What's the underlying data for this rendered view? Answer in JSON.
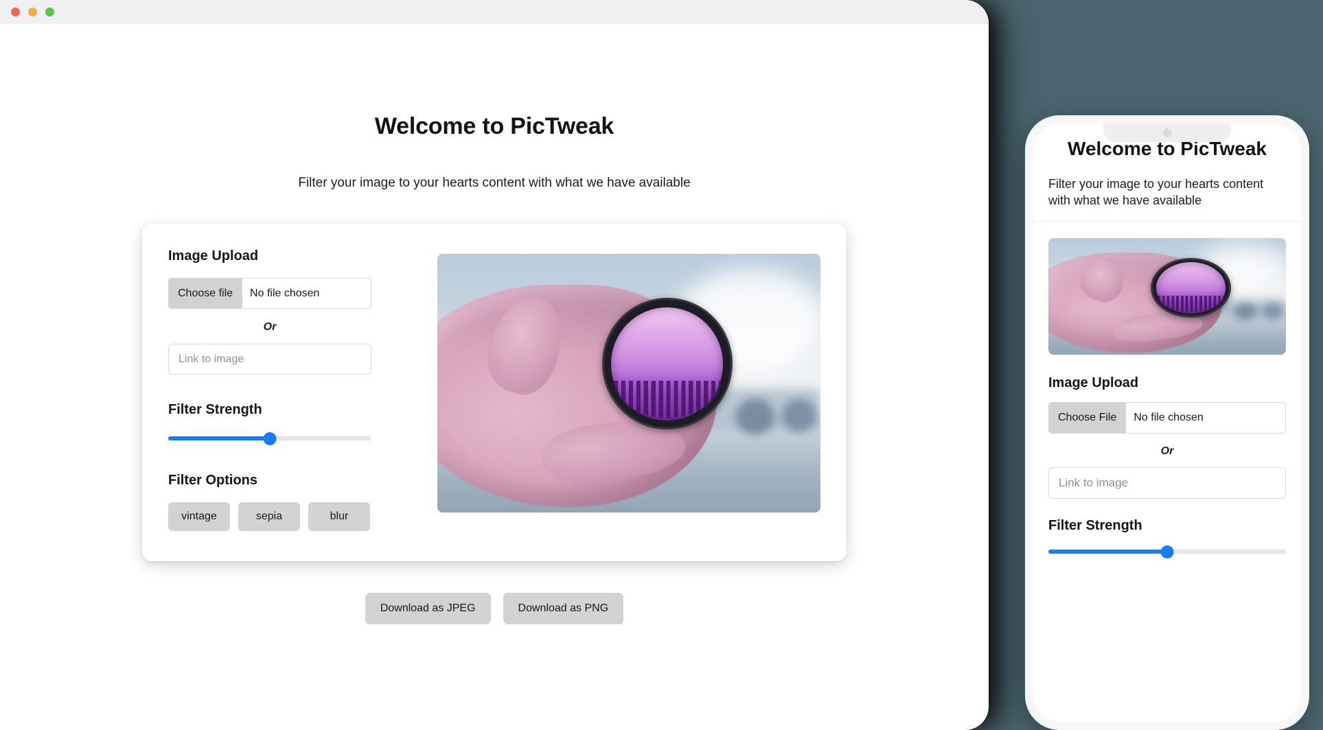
{
  "app": {
    "title": "Welcome to PicTweak",
    "subtitle": "Filter your image to your hearts content with what we have available"
  },
  "window_controls": {
    "close_label": "close",
    "minimize_label": "minimize",
    "maximize_label": "maximize",
    "close_color": "#f2645a",
    "minimize_color": "#eeb040",
    "maximize_color": "#57c749"
  },
  "desktop": {
    "upload": {
      "heading": "Image Upload",
      "file_button_label": "Choose file",
      "file_status": "No file chosen",
      "or_label": "Or",
      "link_placeholder": "Link to image",
      "link_value": ""
    },
    "strength": {
      "heading": "Filter Strength",
      "value": 50,
      "min": 0,
      "max": 100,
      "accent_color": "#1a7ef1",
      "track_color": "#e7e7e9"
    },
    "filters": {
      "heading": "Filter Options",
      "options": [
        "vintage",
        "sepia",
        "blur"
      ]
    },
    "preview": {
      "alt": "hand holding a purple tinted circular lens filter"
    },
    "downloads": [
      "Download as JPEG",
      "Download as PNG"
    ]
  },
  "mobile": {
    "title": "Welcome to PicTweak",
    "subtitle": "Filter your image to your hearts content with what we have available",
    "preview": {
      "alt": "hand holding a purple tinted circular lens filter"
    },
    "upload": {
      "heading": "Image Upload",
      "file_button_label": "Choose File",
      "file_status": "No file chosen",
      "or_label": "Or",
      "link_placeholder": "Link to image",
      "link_value": ""
    },
    "strength": {
      "heading": "Filter Strength",
      "value": 50,
      "min": 0,
      "max": 100,
      "accent_color": "#1a7ef1",
      "track_color": "#e7e7e9"
    }
  },
  "theme": {
    "backdrop_color": "#4b6670",
    "card_background": "#ffffff",
    "button_gray": "#d3d3d3"
  }
}
